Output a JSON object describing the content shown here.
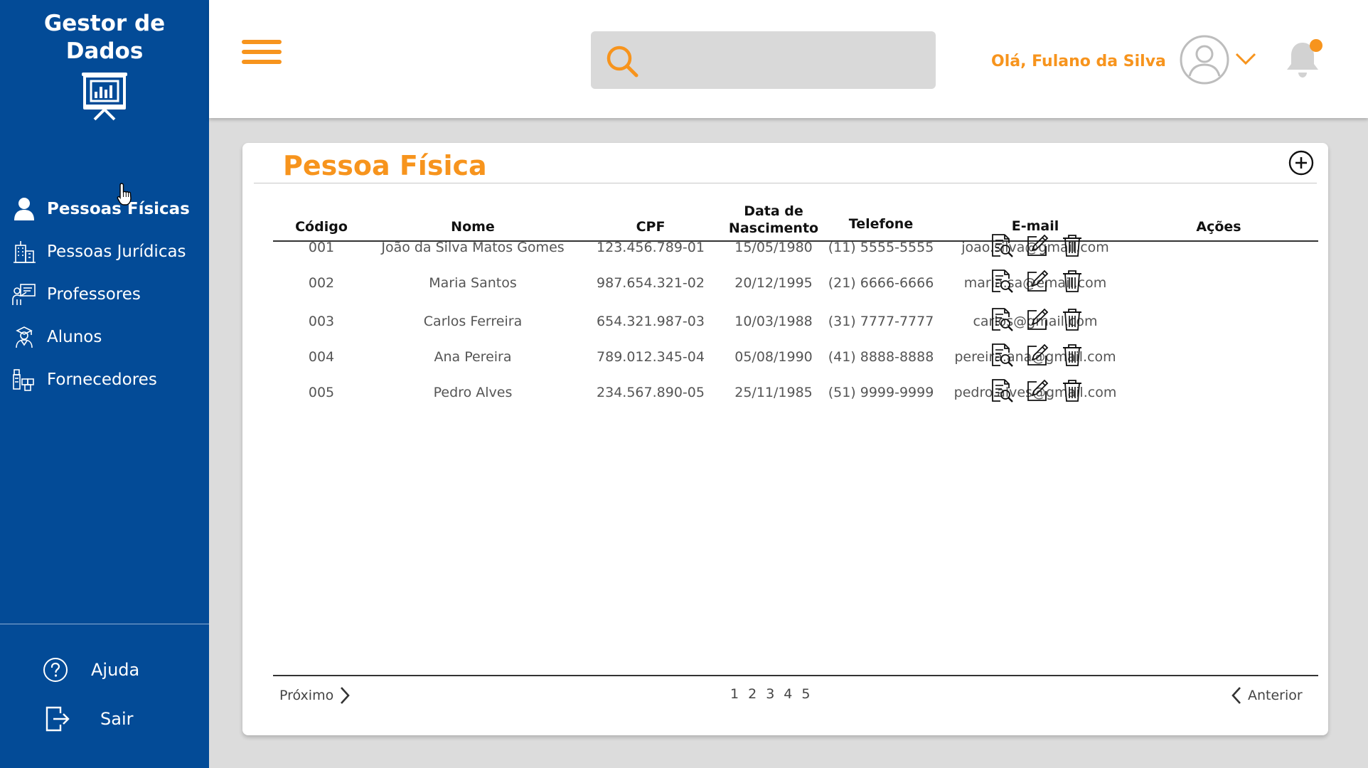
{
  "app": {
    "brand": "Gestor de Dados"
  },
  "sidebar": {
    "items": [
      {
        "label": "Pessoas Físicas",
        "icon": "person-icon",
        "active": true
      },
      {
        "label": "Pessoas Jurídicas",
        "icon": "building-icon"
      },
      {
        "label": "Professores",
        "icon": "teacher-icon"
      },
      {
        "label": "Alunos",
        "icon": "student-icon"
      },
      {
        "label": "Fornecedores",
        "icon": "supplier-icon"
      }
    ],
    "help_label": "Ajuda",
    "logout_label": "Sair"
  },
  "header": {
    "search": {
      "placeholder": "",
      "value": ""
    },
    "greeting": "Olá, Fulano da Silva",
    "notification_dot": true
  },
  "main": {
    "title": "Pessoa Física",
    "columns": [
      "Código",
      "Nome",
      "CPF",
      "Data de Nascimento",
      "Telefone",
      "E-mail",
      "Ações"
    ],
    "rows": [
      {
        "codigo": "001",
        "nome": "João da Silva Matos Gomes",
        "cpf": "123.456.789-01",
        "nascimento": "15/05/1980",
        "telefone": "(11) 5555-5555",
        "email": "joao.silva@gmail.com"
      },
      {
        "codigo": "002",
        "nome": "Maria Santos",
        "cpf": "987.654.321-02",
        "nascimento": "20/12/1995",
        "telefone": "(21) 6666-6666",
        "email": "maria.sa@email.com"
      },
      {
        "codigo": "003",
        "nome": "Carlos Ferreira",
        "cpf": "654.321.987-03",
        "nascimento": "10/03/1988",
        "telefone": "(31) 7777-7777",
        "email": "carlos@gmail.com"
      },
      {
        "codigo": "004",
        "nome": "Ana Pereira",
        "cpf": "789.012.345-04",
        "nascimento": "05/08/1990",
        "telefone": "(41) 8888-8888",
        "email": "pereira.ana@gmail.com"
      },
      {
        "codigo": "005",
        "nome": "Pedro Alves",
        "cpf": "234.567.890-05",
        "nascimento": "25/11/1985",
        "telefone": "(51) 9999-9999",
        "email": "pedro.alves@gmail.com"
      }
    ],
    "pagination": {
      "next_label": "Próximo",
      "prev_label": "Anterior",
      "pages": [
        "1",
        "2",
        "3",
        "4",
        "5"
      ]
    }
  },
  "colors": {
    "sidebar_bg": "#034b97",
    "accent": "#f7941d",
    "background": "#dcdcdc",
    "card": "#ffffff"
  }
}
